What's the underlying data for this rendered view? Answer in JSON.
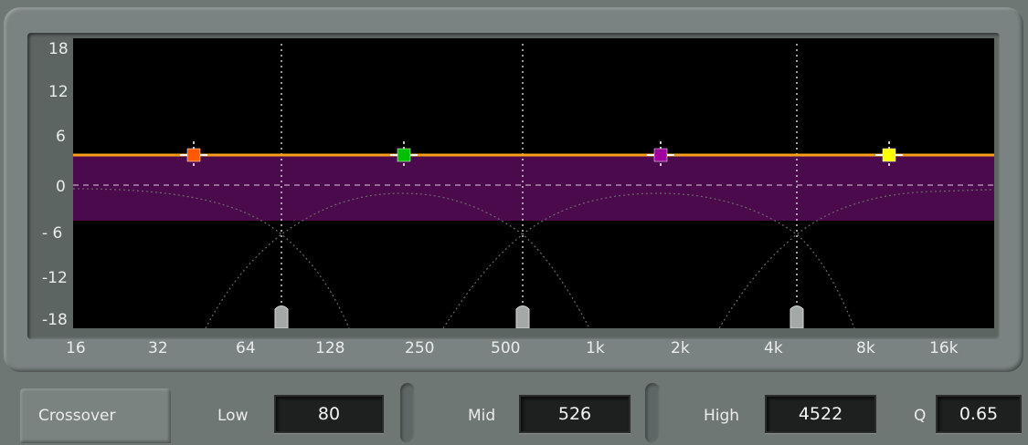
{
  "graph": {
    "y_tick_labels": [
      "18",
      "12",
      "6",
      "0",
      "- 6",
      "-12",
      "-18"
    ],
    "x_tick_labels": [
      "16",
      "32",
      "64",
      "128",
      "250",
      "500",
      "1k",
      "2k",
      "4k",
      "8k",
      "16k"
    ],
    "gain_band_color": "#4b0a4b",
    "gain_line_color": "#ff9f1a",
    "band_markers": [
      {
        "name": "low-band-marker",
        "color": "#ff5a00"
      },
      {
        "name": "low-mid-band-marker",
        "color": "#00c000"
      },
      {
        "name": "high-mid-band-marker",
        "color": "#a000a0"
      },
      {
        "name": "high-band-marker",
        "color": "#ffff00"
      }
    ]
  },
  "controls": {
    "tab_label": "Crossover",
    "low_label": "Low",
    "low_value": "80",
    "mid_label": "Mid",
    "mid_value": "526",
    "high_label": "High",
    "high_value": "4522",
    "q_label": "Q",
    "q_value": "0.65"
  }
}
